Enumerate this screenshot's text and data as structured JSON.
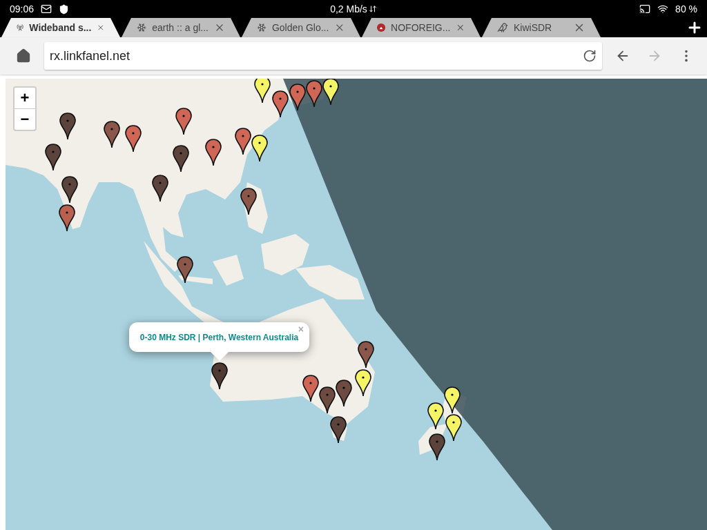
{
  "status_bar": {
    "time": "09:06",
    "speed": "0,2 Mb/s",
    "battery": "80 %"
  },
  "tabs": [
    {
      "title": "Wideband s...",
      "selected": true
    },
    {
      "title": "earth :: a gl...",
      "selected": false
    },
    {
      "title": "Golden Glo...",
      "selected": false
    },
    {
      "title": "NOFOREIG...",
      "selected": false
    },
    {
      "title": "KiwiSDR",
      "selected": false
    }
  ],
  "toolbar": {
    "url": "rx.linkfanel.net",
    "back_disabled": false,
    "forward_disabled": true
  },
  "map": {
    "zoom_in": "+",
    "zoom_out": "−",
    "popup": {
      "text": "0-30 MHz SDR | Perth, Western Australia",
      "close": "×"
    },
    "markers": [
      {
        "color": "#f4f466"
      },
      {
        "color": "#cf6656"
      },
      {
        "color": "#cf6656"
      },
      {
        "color": "#cf6656"
      },
      {
        "color": "#f4f466"
      },
      {
        "color": "#5c443c"
      },
      {
        "color": "#8a574a"
      },
      {
        "color": "#cf6656"
      },
      {
        "color": "#cf6656"
      },
      {
        "color": "#5c443c"
      },
      {
        "color": "#cf6656"
      },
      {
        "color": "#5c443c"
      },
      {
        "color": "#cf6656"
      },
      {
        "color": "#f4f466"
      },
      {
        "color": "#5c443c"
      },
      {
        "color": "#b9604f"
      },
      {
        "color": "#5c443c"
      },
      {
        "color": "#8a574a"
      },
      {
        "color": "#8a574a"
      },
      {
        "color": "#4e3a33"
      },
      {
        "color": "#8a574a"
      },
      {
        "color": "#cf6656"
      },
      {
        "color": "#f4f466"
      },
      {
        "color": "#6e4b40"
      },
      {
        "color": "#6e4b40"
      },
      {
        "color": "#5c443c"
      },
      {
        "color": "#f4f466"
      },
      {
        "color": "#f4f466"
      },
      {
        "color": "#f4f466"
      },
      {
        "color": "#5c443c"
      }
    ]
  }
}
